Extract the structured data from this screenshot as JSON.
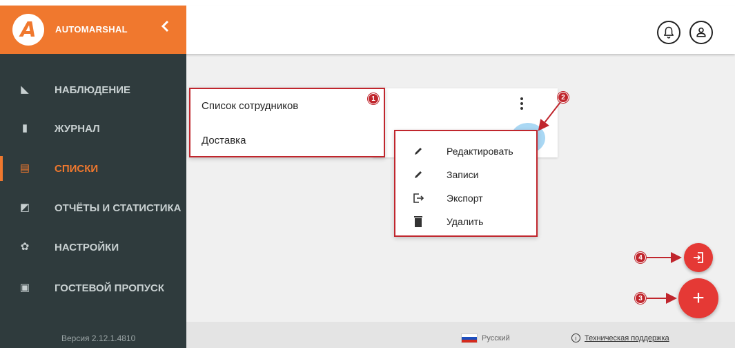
{
  "app": {
    "brand": "AUTOMARSHAL",
    "logo_letter": "A",
    "version": "Версия 2.12.1.4810",
    "accent_color": "#f0782e"
  },
  "header": {
    "icons": [
      "bell-icon",
      "user-icon"
    ]
  },
  "sidebar": {
    "items": [
      {
        "label": "НАБЛЮДЕНИЕ",
        "icon": "binoculars-icon",
        "glyph": "◣",
        "active": false
      },
      {
        "label": "ЖУРНАЛ",
        "icon": "book-icon",
        "glyph": "▮",
        "active": false
      },
      {
        "label": "СПИСКИ",
        "icon": "clipboard-icon",
        "glyph": "▤",
        "active": true
      },
      {
        "label": "ОТЧЁТЫ И СТАТИСТИКА",
        "icon": "chart-icon",
        "glyph": "◩",
        "active": false
      },
      {
        "label": "НАСТРОЙКИ",
        "icon": "gear-icon",
        "glyph": "✿",
        "active": false
      },
      {
        "label": "ГОСТЕВОЙ ПРОПУСК",
        "icon": "guest-pass-icon",
        "glyph": "▣",
        "active": false
      }
    ]
  },
  "list_menu": {
    "items": [
      "Список сотрудников",
      "Доставка"
    ]
  },
  "context_menu": {
    "items": [
      {
        "label": "Редактировать",
        "icon": "pencil-icon"
      },
      {
        "label": "Записи",
        "icon": "pencil-icon"
      },
      {
        "label": "Экспорт",
        "icon": "export-icon"
      },
      {
        "label": "Удалить",
        "icon": "trash-icon"
      }
    ]
  },
  "markers": [
    "1",
    "2",
    "3",
    "4"
  ],
  "footer": {
    "language": "Русский",
    "support": "Техническая поддержка",
    "info_glyph": "i"
  },
  "fab": {
    "add_glyph": "+"
  }
}
